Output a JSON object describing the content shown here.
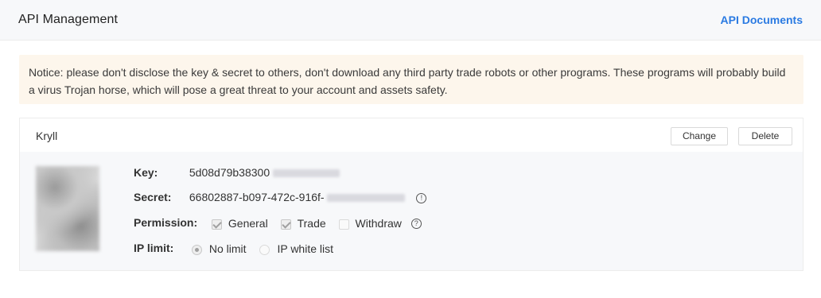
{
  "header": {
    "title": "API Management",
    "docs_link": "API Documents"
  },
  "notice": {
    "text": "Notice: please don't disclose the key & secret to others, don't download any third party trade robots or other programs. These programs will probably build a virus Trojan horse, which will pose a great threat to your account and assets safety."
  },
  "api_card": {
    "name": "Kryll",
    "change_label": "Change",
    "delete_label": "Delete",
    "key_label": "Key:",
    "key_value": "5d08d79b38300",
    "secret_label": "Secret:",
    "secret_value": "66802887-b097-472c-916f-",
    "permission_label": "Permission:",
    "permissions": [
      {
        "label": "General",
        "checked": true
      },
      {
        "label": "Trade",
        "checked": true
      },
      {
        "label": "Withdraw",
        "checked": false
      }
    ],
    "ip_label": "IP limit:",
    "ip_options": [
      {
        "label": "No limit",
        "selected": true
      },
      {
        "label": "IP white list",
        "selected": false
      }
    ]
  }
}
